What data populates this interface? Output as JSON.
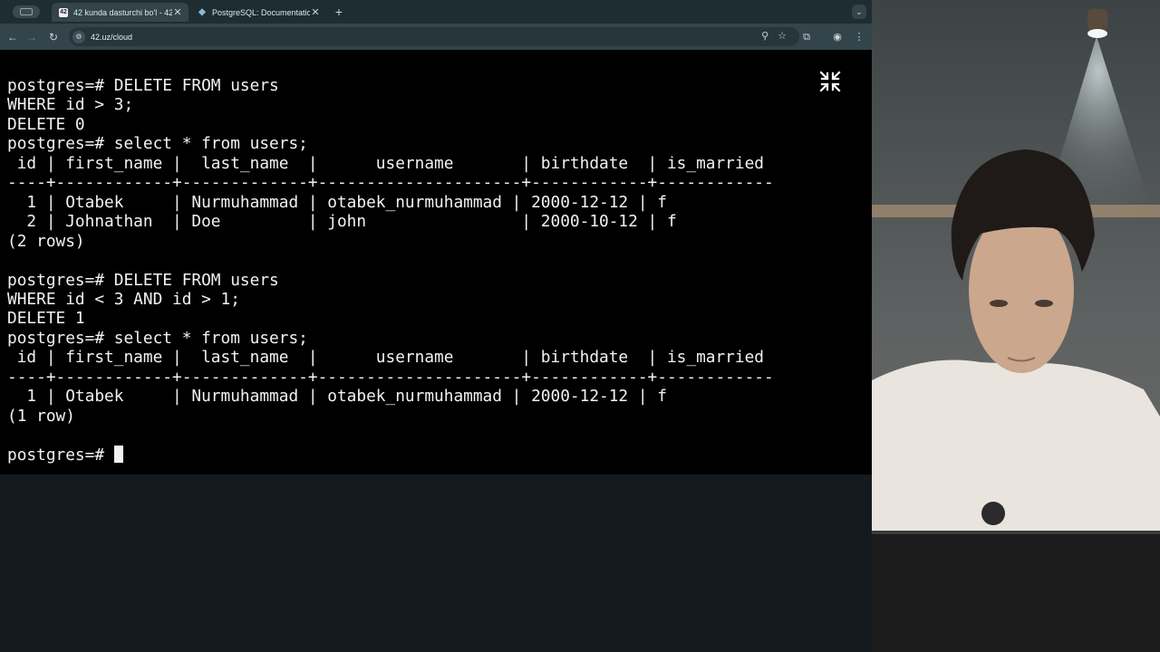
{
  "browser": {
    "tabs": [
      {
        "title": "42 kunda dasturchi bo'l - 42.",
        "favicon": "42",
        "active": true
      },
      {
        "title": "PostgreSQL: Documentation:",
        "favicon": "elephant-icon",
        "active": false
      }
    ],
    "url": "42.uz/cloud"
  },
  "terminal": {
    "lines": [
      "postgres=# DELETE FROM users",
      "WHERE id > 3;",
      "DELETE 0",
      "postgres=# select * from users;",
      " id | first_name |  last_name  |      username       | birthdate  | is_married",
      "----+------------+-------------+---------------------+------------+------------",
      "  1 | Otabek     | Nurmuhammad | otabek_nurmuhammad | 2000-12-12 | f",
      "  2 | Johnathan  | Doe         | john                | 2000-10-12 | f",
      "(2 rows)",
      "",
      "postgres=# DELETE FROM users",
      "WHERE id < 3 AND id > 1;",
      "DELETE 1",
      "postgres=# select * from users;",
      " id | first_name |  last_name  |      username       | birthdate  | is_married",
      "----+------------+-------------+---------------------+------------+------------",
      "  1 | Otabek     | Nurmuhammad | otabek_nurmuhammad | 2000-12-12 | f",
      "(1 row)",
      ""
    ],
    "prompt": "postgres=# "
  },
  "colors": {
    "terminal_bg": "#000000",
    "terminal_fg": "#f2f2f2",
    "tabbar_bg": "#1e2d31",
    "toolbar_bg": "#33454a"
  },
  "icons": {
    "exit_fullscreen": "exit-fullscreen-icon"
  }
}
